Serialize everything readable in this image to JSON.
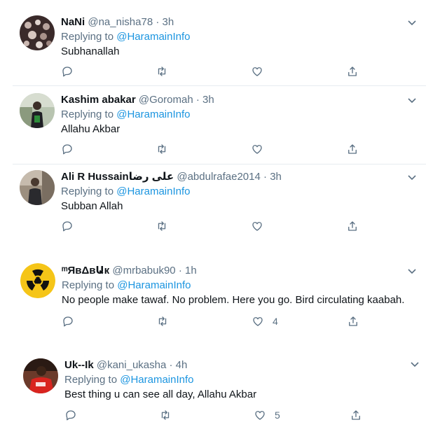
{
  "replies": [
    {
      "name": "NaNi",
      "handle": "@na_nisha78",
      "separator": "·",
      "time": "3h",
      "replying_prefix": "Replying to",
      "replying_to": "@HaramainInfo",
      "text": "Subhanallah",
      "like_count": ""
    },
    {
      "name": "Kashim abakar",
      "handle": "@Goromah",
      "separator": "·",
      "time": "3h",
      "replying_prefix": "Replying to",
      "replying_to": "@HaramainInfo",
      "text": "Allahu Akbar",
      "like_count": ""
    },
    {
      "name": "Ali R Hussainعلی رضا",
      "handle": "@abdulrafae2014",
      "separator": "·",
      "time": "3h",
      "replying_prefix": "Replying to",
      "replying_to": "@HaramainInfo",
      "text": "Subban Allah",
      "like_count": ""
    },
    {
      "name": "ᵐЯвΔвԱк",
      "handle": "@mrbabuk90",
      "separator": "·",
      "time": "1h",
      "replying_prefix": "Replying to",
      "replying_to": "@HaramainInfo",
      "text": "No people make tawaf. No problem. Here you go. Bird circulating kaabah.",
      "like_count": "4"
    },
    {
      "name": "Uk--Ik",
      "handle": "@kani_ukasha",
      "separator": "·",
      "time": "4h",
      "replying_prefix": "Replying to",
      "replying_to": "@HaramainInfo",
      "text": "Best thing u can see all day, Allahu Akbar",
      "like_count": "5"
    }
  ],
  "icons": [
    "chevron-down-icon",
    "reply-icon",
    "retweet-icon",
    "like-icon",
    "share-icon"
  ],
  "colors": {
    "text": "#0f1419",
    "secondary": "#5b7083",
    "link": "#1b95e0",
    "divider": "#e6ecf0",
    "icon": "#5b7083"
  }
}
